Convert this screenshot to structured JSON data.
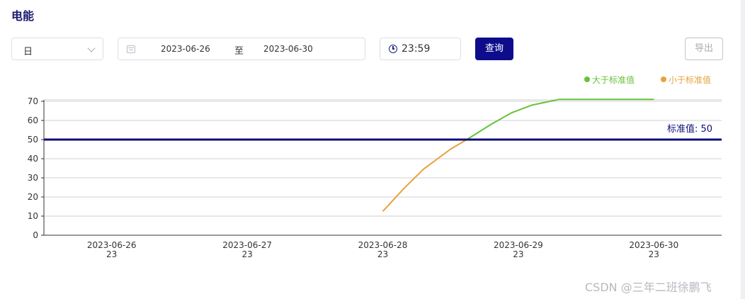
{
  "page": {
    "title": "电能"
  },
  "filters": {
    "period_value": "日",
    "date_start": "2023-06-26",
    "date_separator": "至",
    "date_end": "2023-06-30",
    "time_value": "23:59",
    "query_label": "查询",
    "export_label": "导出"
  },
  "legend": {
    "above_label": "大于标准值",
    "below_label": "小于标准值"
  },
  "colors": {
    "above": "#67c23a",
    "below": "#e6a23c",
    "standard_line": "#0d0d7a",
    "accent": "#0d0d8c"
  },
  "icons": {
    "period_select": "chevron-down-icon",
    "date_range": "calendar-icon",
    "time": "clock-icon"
  },
  "watermark": "CSDN @三年二班徐鹏飞",
  "chart_data": {
    "type": "line",
    "x_tick_labels": [
      {
        "date": "2023-06-26",
        "hour": "23"
      },
      {
        "date": "2023-06-27",
        "hour": "23"
      },
      {
        "date": "2023-06-28",
        "hour": "23"
      },
      {
        "date": "2023-06-29",
        "hour": "23"
      },
      {
        "date": "2023-06-30",
        "hour": "23"
      }
    ],
    "y_ticks": [
      0,
      10,
      20,
      30,
      40,
      50,
      60,
      70
    ],
    "ylim": [
      0,
      70
    ],
    "grid": true,
    "standard_value": 50,
    "standard_label": "标准值: 50",
    "series": [
      {
        "points": [
          {
            "x": 2.0,
            "y": 12.5
          },
          {
            "x": 2.15,
            "y": 24
          },
          {
            "x": 2.3,
            "y": 34.5
          },
          {
            "x": 2.5,
            "y": 45
          },
          {
            "x": 2.62,
            "y": 50
          },
          {
            "x": 2.8,
            "y": 58
          },
          {
            "x": 2.95,
            "y": 64
          },
          {
            "x": 3.1,
            "y": 68
          },
          {
            "x": 3.3,
            "y": 71
          },
          {
            "x": 3.6,
            "y": 71
          },
          {
            "x": 4.0,
            "y": 71
          }
        ]
      }
    ]
  }
}
